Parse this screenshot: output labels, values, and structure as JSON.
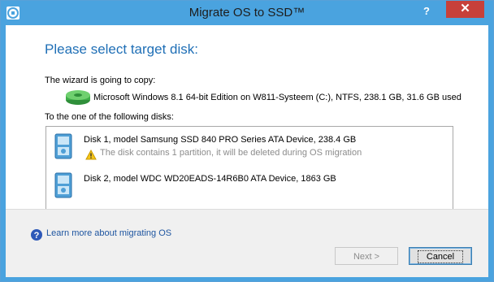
{
  "window": {
    "title": "Migrate OS to SSD™",
    "help_glyph": "?",
    "close_glyph": "✕"
  },
  "page": {
    "heading": "Please select target disk:",
    "copy_label": "The wizard is going to copy:",
    "os_description": "Microsoft Windows 8.1 64-bit Edition on W811-Systeem (C:), NTFS, 238.1 GB, 31.6 GB used",
    "target_label": "To the one of the following disks:"
  },
  "disks": [
    {
      "title": "Disk 1, model Samsung SSD 840 PRO Series ATA Device, 238.4 GB",
      "warning": "The disk contains 1 partition, it will be deleted during OS migration"
    },
    {
      "title": "Disk 2, model WDC WD20EADS-14R6B0 ATA Device, 1863 GB",
      "warning": ""
    }
  ],
  "footer": {
    "learn_more": "Learn more about migrating OS",
    "next_label": "Next >",
    "cancel_label": "Cancel"
  },
  "colors": {
    "titlebar": "#4aa3df",
    "heading": "#1f6fb6",
    "close": "#c7403a",
    "link": "#1e55a0"
  },
  "icons": {
    "app": "app-icon",
    "os": "windows-disk-icon",
    "disk": "hard-disk-icon",
    "warning": "warning-icon",
    "help": "question-icon"
  }
}
